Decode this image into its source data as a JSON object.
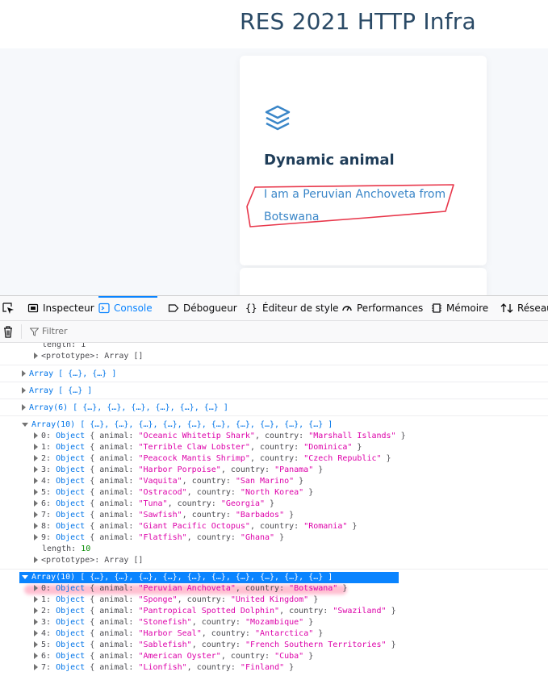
{
  "site": {
    "title": "RES 2021 HTTP Infra",
    "card_title": "Dynamic animal",
    "card_text": "I am a Peruvian Anchoveta from Botswana",
    "card_icon": "layers-icon"
  },
  "devtools": {
    "tabs": [
      {
        "label": "Inspecteur",
        "icon": "inspector-icon"
      },
      {
        "label": "Console",
        "icon": "console-icon"
      },
      {
        "label": "Débogueur",
        "icon": "debugger-icon"
      },
      {
        "label": "Éditeur de style",
        "icon": "style-editor-icon"
      },
      {
        "label": "Performances",
        "icon": "performance-icon"
      },
      {
        "label": "Mémoire",
        "icon": "memory-icon"
      },
      {
        "label": "Réseau",
        "icon": "network-icon"
      }
    ],
    "filter_placeholder": "Filtrer",
    "console": {
      "top_length": "length: 1",
      "top_prototype": "<prototype>: Array []",
      "log1": "Array [ {…}, {…} ]",
      "log2": "Array [ {…} ]",
      "log3": "Array(6) [ {…}, {…}, {…}, {…}, {…}, {…} ]",
      "log4": "Array(10) [ {…}, {…}, {…}, {…}, {…}, {…}, {…}, {…}, {…}, {…} ]",
      "list1": [
        {
          "idx": "0",
          "animal": "\"Oceanic Whitetip Shark\"",
          "country": "\"Marshall Islands\""
        },
        {
          "idx": "1",
          "animal": "\"Terrible Claw Lobster\"",
          "country": "\"Dominica\""
        },
        {
          "idx": "2",
          "animal": "\"Peacock Mantis Shrimp\"",
          "country": "\"Czech Republic\""
        },
        {
          "idx": "3",
          "animal": "\"Harbor Porpoise\"",
          "country": "\"Panama\""
        },
        {
          "idx": "4",
          "animal": "\"Vaquita\"",
          "country": "\"San Marino\""
        },
        {
          "idx": "5",
          "animal": "\"Ostracod\"",
          "country": "\"North Korea\""
        },
        {
          "idx": "6",
          "animal": "\"Tuna\"",
          "country": "\"Georgia\""
        },
        {
          "idx": "7",
          "animal": "\"Sawfish\"",
          "country": "\"Barbados\""
        },
        {
          "idx": "8",
          "animal": "\"Giant Pacific Octopus\"",
          "country": "\"Romania\""
        },
        {
          "idx": "9",
          "animal": "\"Flatfish\"",
          "country": "\"Ghana\""
        }
      ],
      "list1_length_key": "length:",
      "list1_length_val": "10",
      "list1_prototype": "<prototype>: Array []",
      "log5": "Array(10) [ {…}, {…}, {…}, {…}, {…}, {…}, {…}, {…}, {…}, {…} ]",
      "list2": [
        {
          "idx": "0",
          "animal": "\"Peruvian Anchoveta\"",
          "country": "\"Botswana\""
        },
        {
          "idx": "1",
          "animal": "\"Sponge\"",
          "country": "\"United Kingdom\""
        },
        {
          "idx": "2",
          "animal": "\"Pantropical Spotted Dolphin\"",
          "country": "\"Swaziland\""
        },
        {
          "idx": "3",
          "animal": "\"Stonefish\"",
          "country": "\"Mozambique\""
        },
        {
          "idx": "4",
          "animal": "\"Harbor Seal\"",
          "country": "\"Antarctica\""
        },
        {
          "idx": "5",
          "animal": "\"Sablefish\"",
          "country": "\"French Southern Territories\""
        },
        {
          "idx": "6",
          "animal": "\"American Oyster\"",
          "country": "\"Cuba\""
        },
        {
          "idx": "7",
          "animal": "\"Lionfish\"",
          "country": "\"Finland\""
        }
      ],
      "obj_label": "Object",
      "animal_key": "animal:",
      "country_key": "country:"
    }
  },
  "colors": {
    "accent": "#0a84ff",
    "title": "#2a4a66",
    "link": "#3a86c8",
    "annotation": "#e8364a"
  }
}
